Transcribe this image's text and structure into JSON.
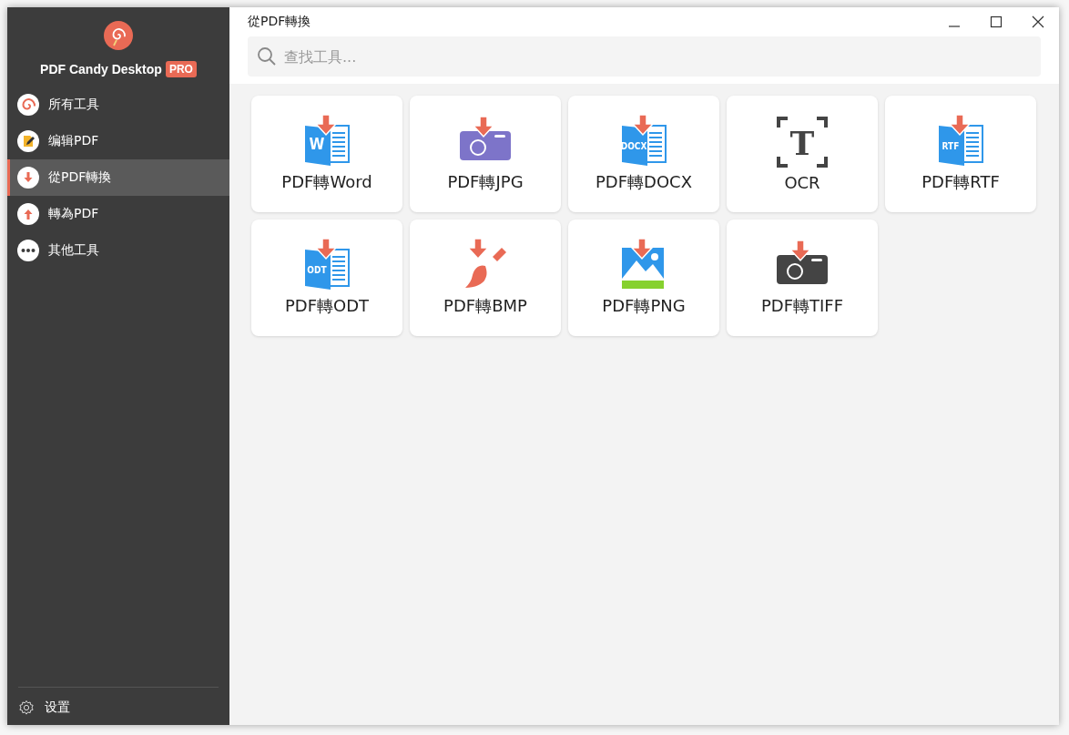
{
  "app": {
    "name": "PDF Candy Desktop",
    "badge": "PRO"
  },
  "sidebar": {
    "items": [
      {
        "label": "所有工具",
        "selected": false
      },
      {
        "label": "编辑PDF",
        "selected": false
      },
      {
        "label": "從PDF轉換",
        "selected": true
      },
      {
        "label": "轉為PDF",
        "selected": false
      },
      {
        "label": "其他工具",
        "selected": false
      }
    ],
    "settings": "设置"
  },
  "window": {
    "title": "從PDF轉換"
  },
  "search": {
    "placeholder": "查找工具..."
  },
  "tools": [
    {
      "label": "PDF轉Word",
      "kind": "doc",
      "icon_text": "W"
    },
    {
      "label": "PDF轉JPG",
      "kind": "camera-purple"
    },
    {
      "label": "PDF轉DOCX",
      "kind": "doc",
      "icon_text": "DOCX"
    },
    {
      "label": "OCR",
      "kind": "ocr",
      "icon_text": "T"
    },
    {
      "label": "PDF轉RTF",
      "kind": "doc",
      "icon_text": "RTF"
    },
    {
      "label": "PDF轉ODT",
      "kind": "doc",
      "icon_text": "ODT"
    },
    {
      "label": "PDF轉BMP",
      "kind": "brush"
    },
    {
      "label": "PDF轉PNG",
      "kind": "image"
    },
    {
      "label": "PDF轉TIFF",
      "kind": "camera-dark"
    }
  ]
}
